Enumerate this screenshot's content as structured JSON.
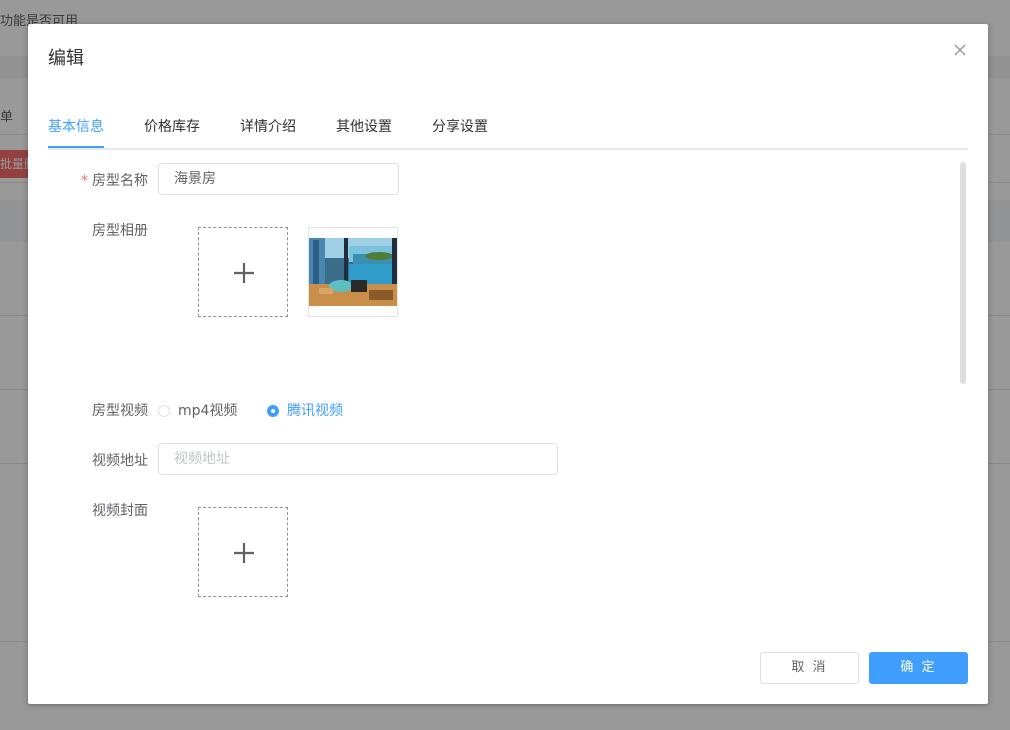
{
  "background": {
    "top_text": "功能是否可用",
    "row_label": "单",
    "red_button_label": "批量删除"
  },
  "dialog": {
    "title": "编辑",
    "tabs": [
      {
        "label": "基本信息",
        "active": true
      },
      {
        "label": "价格库存",
        "active": false
      },
      {
        "label": "详情介绍",
        "active": false
      },
      {
        "label": "其他设置",
        "active": false
      },
      {
        "label": "分享设置",
        "active": false
      }
    ],
    "form": {
      "room_type_name": {
        "label": "房型名称",
        "required": true,
        "value": "海景房"
      },
      "album": {
        "label": "房型相册",
        "upload_icon": "plus-icon",
        "images": [
          "room-photo-ocean-view"
        ]
      },
      "video": {
        "label": "房型视频",
        "options": [
          "mp4视频",
          "腾讯视频"
        ],
        "selected": "腾讯视频"
      },
      "video_url": {
        "label": "视频地址",
        "placeholder": "视频地址",
        "value": ""
      },
      "video_cover": {
        "label": "视频封面",
        "upload_icon": "plus-icon"
      }
    },
    "footer": {
      "cancel_label": "取 消",
      "confirm_label": "确 定"
    }
  },
  "colors": {
    "accent": "#409eff",
    "required": "#f56c6c",
    "text": "#606266"
  }
}
